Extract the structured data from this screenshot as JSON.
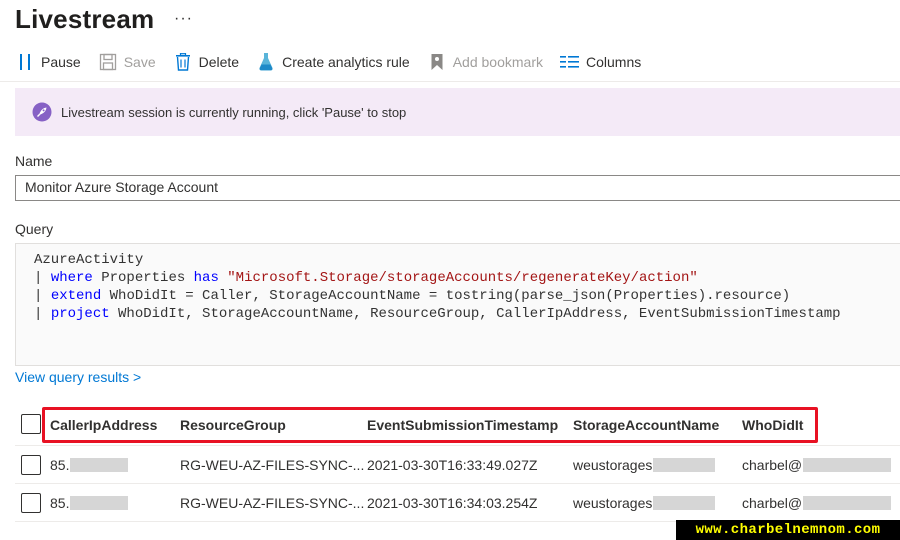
{
  "header": {
    "title": "Livestream",
    "more": "···"
  },
  "toolbar": {
    "pause": "Pause",
    "save": "Save",
    "delete": "Delete",
    "create_rule": "Create analytics rule",
    "add_bookmark": "Add bookmark",
    "columns": "Columns"
  },
  "banner": {
    "text": "Livestream session is currently running, click 'Pause' to stop"
  },
  "form": {
    "name_label": "Name",
    "name_value": "Monitor Azure Storage Account",
    "query_label": "Query"
  },
  "query": {
    "line1": "AzureActivity",
    "line2_kw": "where",
    "line2_a": " Properties ",
    "line2_kw2": "has",
    "line2_str": "\"Microsoft.Storage/storageAccounts/regenerateKey/action\"",
    "line3_kw": "extend",
    "line3_rest": " WhoDidIt = Caller, StorageAccountName = tostring(parse_json(Properties).resource)",
    "line4_kw": "project",
    "line4_rest": " WhoDidIt, StorageAccountName, ResourceGroup, CallerIpAddress, EventSubmissionTimestamp"
  },
  "view_results": "View query results >",
  "table": {
    "columns": [
      "CallerIpAddress",
      "ResourceGroup",
      "EventSubmissionTimestamp",
      "StorageAccountName",
      "WhoDidIt"
    ],
    "rows": [
      [
        "85.",
        "RG-WEU-AZ-FILES-SYNC-...",
        "2021-03-30T16:33:49.027Z",
        "weustorages",
        "charbel@"
      ],
      [
        "85.",
        "RG-WEU-AZ-FILES-SYNC-...",
        "2021-03-30T16:34:03.254Z",
        "weustorages",
        "charbel@"
      ]
    ]
  },
  "watermark": "www.charbelnemnom.com",
  "colors": {
    "accent": "#0078d4",
    "banner_bg": "#f4eaf7",
    "highlight": "#e81123"
  }
}
